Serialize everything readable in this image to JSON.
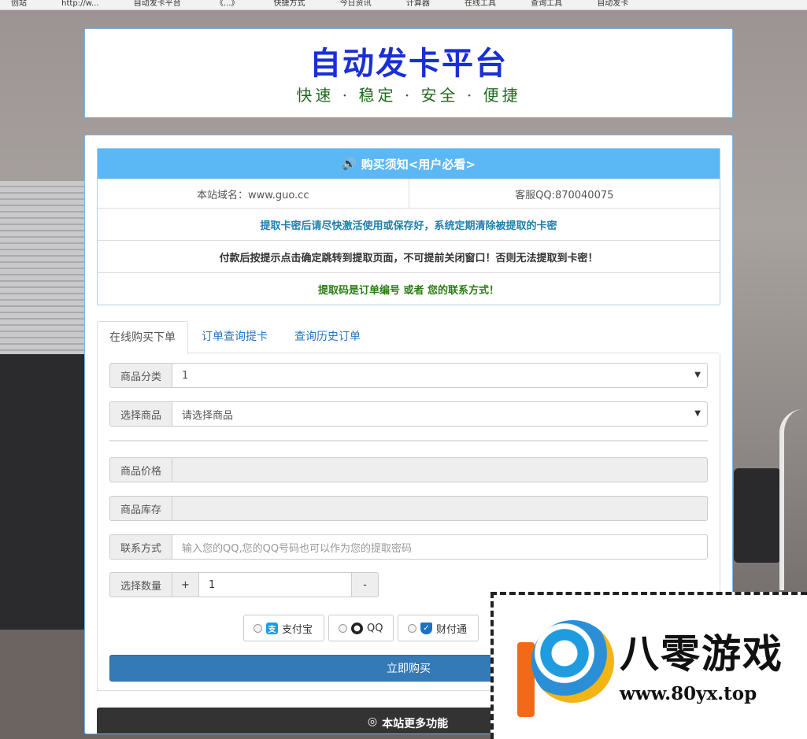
{
  "bookmarks": [
    "创站",
    "http://w...",
    "自动发卡平台",
    "《...》",
    "快捷方式",
    "今日资讯",
    "计算器",
    "在线工具",
    "查询工具",
    "自动发卡"
  ],
  "header": {
    "title": "自动发卡平台",
    "slogan": "快速 · 稳定 · 安全 · 便捷"
  },
  "notice": {
    "heading": "购买须知<用户必看>",
    "domain": "本站域名：www.guo.cc",
    "support": "客服QQ:870040075",
    "line1": "提取卡密后请尽快激活使用或保存好，系统定期清除被提取的卡密",
    "line2": "付款后按提示点击确定跳转到提取页面，不可提前关闭窗口！否则无法提取到卡密！",
    "line3": "提取码是订单编号 或者 您的联系方式！",
    "colors": {
      "header_bg": "#5cb8f5",
      "blue": "#1f7fae",
      "green": "#2a7d12"
    }
  },
  "tabs": [
    "在线购买下单",
    "订单查询提卡",
    "查询历史订单"
  ],
  "form": {
    "category": {
      "label": "商品分类",
      "value": "1"
    },
    "product": {
      "label": "选择商品",
      "value": "请选择商品"
    },
    "price": {
      "label": "商品价格",
      "value": ""
    },
    "stock": {
      "label": "商品库存",
      "value": ""
    },
    "contact": {
      "label": "联系方式",
      "placeholder": "输入您的QQ,您的QQ号码也可以作为您的提取密码"
    },
    "quantity": {
      "label": "选择数量",
      "plus": "+",
      "value": "1",
      "minus": "-"
    }
  },
  "payments": [
    {
      "label": "支付宝",
      "icon": "alipay-icon"
    },
    {
      "label": "QQ",
      "icon": "qq-penguin-icon"
    },
    {
      "label": "财付通",
      "icon": "tenpay-shield-icon"
    }
  ],
  "buy_label": "立即购买",
  "more_label": "本站更多功能",
  "watermark": {
    "name": "八零游戏",
    "url": "www.80yx.top"
  }
}
